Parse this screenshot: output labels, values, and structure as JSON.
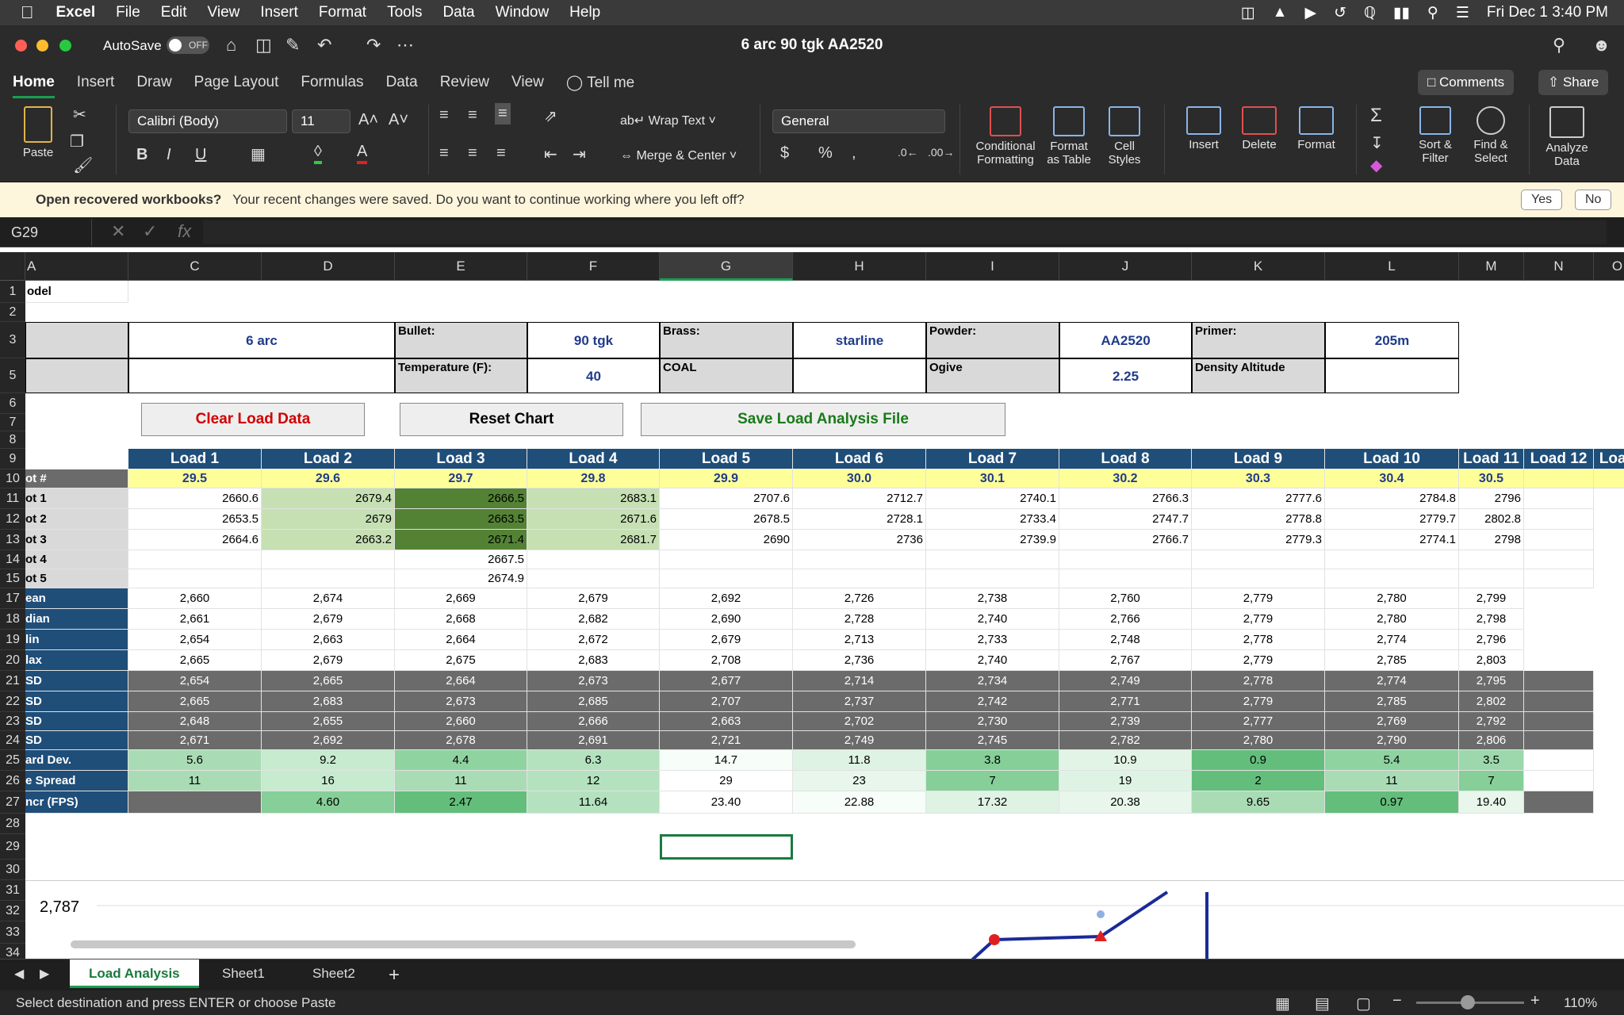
{
  "menubar": {
    "app": "Excel",
    "items": [
      "File",
      "Edit",
      "View",
      "Insert",
      "Format",
      "Tools",
      "Data",
      "Window",
      "Help"
    ],
    "clock": "Fri Dec 1  3:40 PM"
  },
  "titlebar": {
    "autosave_label": "AutoSave",
    "autosave_state": "OFF",
    "doc_title": "6 arc 90 tgk AA2520"
  },
  "ribbon_tabs": [
    "Home",
    "Insert",
    "Draw",
    "Page Layout",
    "Formulas",
    "Data",
    "Review",
    "View"
  ],
  "tell_me": "Tell me",
  "comments_label": "Comments",
  "share_label": "Share",
  "ribbon": {
    "paste": "Paste",
    "font_name": "Calibri (Body)",
    "font_size": "11",
    "wrap_text": "Wrap Text",
    "merge_center": "Merge & Center",
    "number_format": "General",
    "conditional_formatting": [
      "Conditional",
      "Formatting"
    ],
    "format_as_table": [
      "Format",
      "as Table"
    ],
    "cell_styles": [
      "Cell",
      "Styles"
    ],
    "insert": "Insert",
    "delete": "Delete",
    "format": "Format",
    "sort_filter": [
      "Sort &",
      "Filter"
    ],
    "find_select": [
      "Find &",
      "Select"
    ],
    "analyze_data": [
      "Analyze",
      "Data"
    ]
  },
  "infobar": {
    "title": "Open recovered workbooks?",
    "message": "Your recent changes were saved. Do you want to continue working where you left off?",
    "yes": "Yes",
    "no": "No"
  },
  "namebox": "G29",
  "columns": [
    "A",
    "C",
    "D",
    "E",
    "F",
    "G",
    "H",
    "I",
    "J",
    "K",
    "L",
    "M",
    "N",
    "O"
  ],
  "rows": [
    "1",
    "2",
    "3",
    "5",
    "6",
    "7",
    "8",
    "9",
    "10",
    "11",
    "12",
    "13",
    "14",
    "15",
    "17",
    "18",
    "19",
    "20",
    "21",
    "22",
    "23",
    "24",
    "25",
    "26",
    "27",
    "28",
    "29",
    "30",
    "31",
    "32",
    "33",
    "34"
  ],
  "sheet": {
    "a1": "odel",
    "info": {
      "cartridge": "6 arc",
      "bullet_label": "Bullet:",
      "bullet": "90 tgk",
      "brass_label": "Brass:",
      "brass": "starline",
      "powder_label": "Powder:",
      "powder": "AA2520",
      "primer_label": "Primer:",
      "primer": "205m",
      "temp_label": "Temperature (F):",
      "temp": "40",
      "coal_label": "COAL",
      "ogive_label": "Ogive",
      "ogive": "2.25",
      "da_label": "Density Altitude"
    },
    "buttons": {
      "clear": "Clear Load Data",
      "reset": "Reset Chart",
      "save": "Save Load Analysis File"
    },
    "load_headers": [
      "Load 1",
      "Load 2",
      "Load 3",
      "Load 4",
      "Load 5",
      "Load 6",
      "Load 7",
      "Load 8",
      "Load 9",
      "Load 10",
      "Load 11",
      "Load 12",
      "Load"
    ],
    "lot_label": "ot #",
    "lots": [
      "29.5",
      "29.6",
      "29.7",
      "29.8",
      "29.9",
      "30.0",
      "30.1",
      "30.2",
      "30.3",
      "30.4",
      "30.5",
      "",
      ""
    ],
    "row_labels": [
      "ot 1",
      "ot 2",
      "ot 3",
      "ot 4",
      "ot 5",
      "ean",
      "dian",
      "lin",
      "lax",
      " SD",
      " SD",
      " SD",
      " SD",
      "ard Dev.",
      "e Spread",
      "ncr (FPS)"
    ],
    "shots": [
      [
        "2660.6",
        "2679.4",
        "2666.5",
        "2683.1",
        "2707.6",
        "2712.7",
        "2740.1",
        "2766.3",
        "2777.6",
        "2784.8",
        "2796"
      ],
      [
        "2653.5",
        "2679",
        "2663.5",
        "2671.6",
        "2678.5",
        "2728.1",
        "2733.4",
        "2747.7",
        "2778.8",
        "2779.7",
        "2802.8"
      ],
      [
        "2664.6",
        "2663.2",
        "2671.4",
        "2681.7",
        "2690",
        "2736",
        "2739.9",
        "2766.7",
        "2779.3",
        "2774.1",
        "2798"
      ],
      [
        "",
        "",
        "2667.5",
        "",
        "",
        "",
        "",
        "",
        "",
        "",
        ""
      ],
      [
        "",
        "",
        "2674.9",
        "",
        "",
        "",
        "",
        "",
        "",
        "",
        ""
      ]
    ],
    "stats": [
      [
        "2,660",
        "2,674",
        "2,669",
        "2,679",
        "2,692",
        "2,726",
        "2,738",
        "2,760",
        "2,779",
        "2,780",
        "2,799"
      ],
      [
        "2,661",
        "2,679",
        "2,668",
        "2,682",
        "2,690",
        "2,728",
        "2,740",
        "2,766",
        "2,779",
        "2,780",
        "2,798"
      ],
      [
        "2,654",
        "2,663",
        "2,664",
        "2,672",
        "2,679",
        "2,713",
        "2,733",
        "2,748",
        "2,778",
        "2,774",
        "2,796"
      ],
      [
        "2,665",
        "2,679",
        "2,675",
        "2,683",
        "2,708",
        "2,736",
        "2,740",
        "2,767",
        "2,779",
        "2,785",
        "2,803"
      ]
    ],
    "sd_rows": [
      [
        "2,654",
        "2,665",
        "2,664",
        "2,673",
        "2,677",
        "2,714",
        "2,734",
        "2,749",
        "2,778",
        "2,774",
        "2,795"
      ],
      [
        "2,665",
        "2,683",
        "2,673",
        "2,685",
        "2,707",
        "2,737",
        "2,742",
        "2,771",
        "2,779",
        "2,785",
        "2,802"
      ],
      [
        "2,648",
        "2,655",
        "2,660",
        "2,666",
        "2,663",
        "2,702",
        "2,730",
        "2,739",
        "2,777",
        "2,769",
        "2,792"
      ],
      [
        "2,671",
        "2,692",
        "2,678",
        "2,691",
        "2,721",
        "2,749",
        "2,745",
        "2,782",
        "2,780",
        "2,790",
        "2,806"
      ]
    ],
    "std_dev": [
      "5.6",
      "9.2",
      "4.4",
      "6.3",
      "14.7",
      "11.8",
      "3.8",
      "10.9",
      "0.9",
      "5.4",
      "3.5"
    ],
    "spread": [
      "11",
      "16",
      "11",
      "12",
      "29",
      "23",
      "7",
      "19",
      "2",
      "11",
      "7"
    ],
    "incr": [
      "",
      "4.60",
      "2.47",
      "11.64",
      "23.40",
      "22.88",
      "17.32",
      "20.38",
      "9.65",
      "0.97",
      "19.40"
    ],
    "chart_top_label": "2,787"
  },
  "sheet_tabs": [
    "Load Analysis",
    "Sheet1",
    "Sheet2"
  ],
  "status": {
    "message": "Select destination and press ENTER or choose Paste",
    "zoom": "110%"
  }
}
